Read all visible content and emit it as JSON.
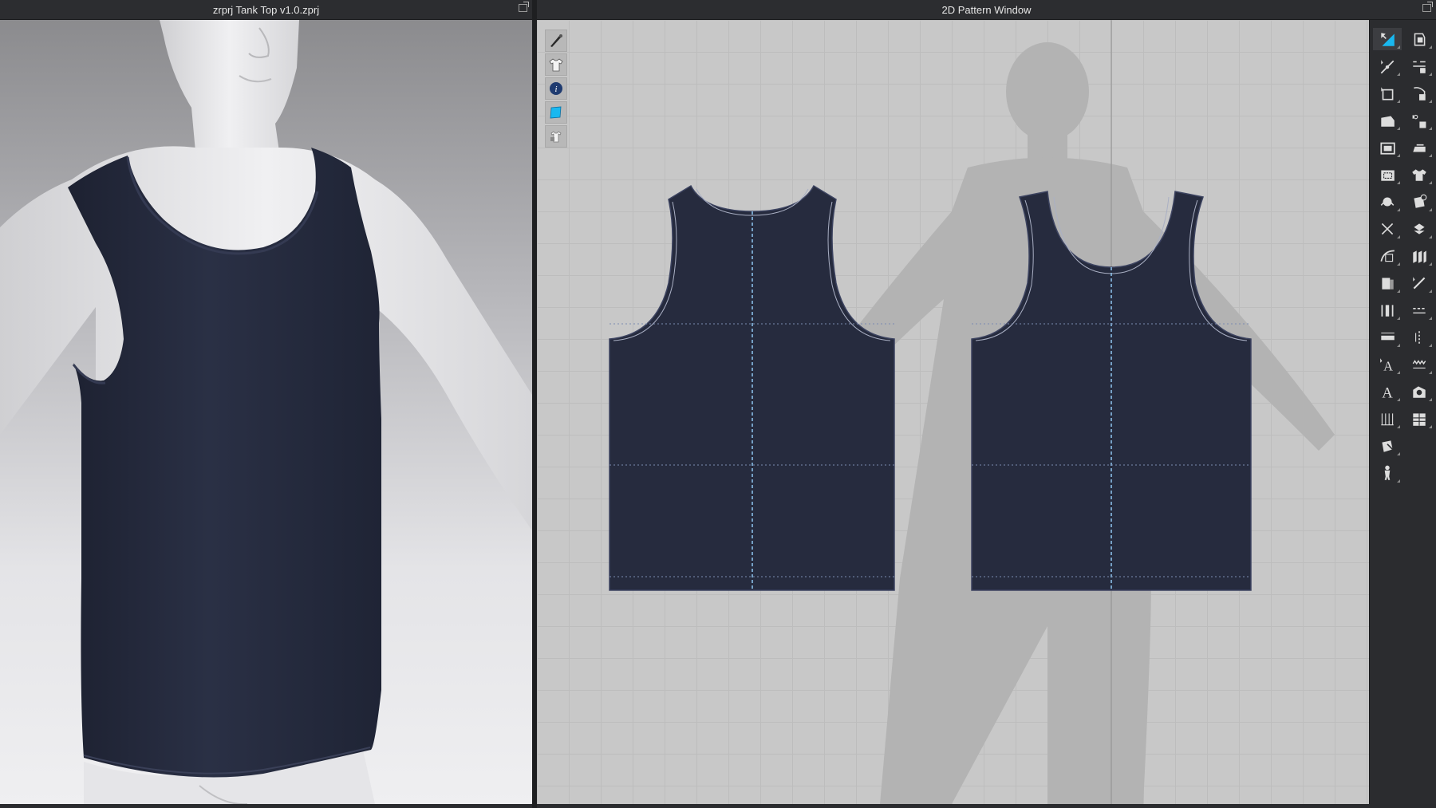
{
  "windows": {
    "view3d_title": "zrprj Tank Top v1.0.zprj",
    "view2d_title": "2D Pattern Window"
  },
  "colors": {
    "garment": "#262b3e",
    "avatar": "#e2e2e4",
    "highlight": "#19b8f0"
  },
  "mini_tools": [
    {
      "icon": "brush-icon"
    },
    {
      "icon": "shirt-icon"
    },
    {
      "icon": "info-icon"
    },
    {
      "icon": "fabric-icon"
    },
    {
      "icon": "lock-shirt-icon"
    }
  ],
  "toolbar": {
    "left": [
      "select-pattern-icon",
      "edit-pattern-icon",
      "transform-pattern-icon",
      "polygon-icon",
      "rectangle-icon",
      "internal-rectangle-icon",
      "dart-icon",
      "cut-icon",
      "edit-curvature-icon",
      "fold-icon",
      "segment-icon",
      "ruler-icon",
      "text-a-icon",
      "text-style-icon",
      "grid-icon",
      "trim-icon",
      "avatar-measure-icon"
    ],
    "right": [
      "seam-icon",
      "segment-sewing-icon",
      "free-sewing-icon",
      "sewing-check-icon",
      "iron-icon",
      "shirt-symmetry-icon",
      "puckering-icon",
      "fold-arrange-icon",
      "layer-icon",
      "tape-icon",
      "stitch-icon",
      "topstitch-icon",
      "zigzag-stitch-icon",
      "button-icon",
      "buttonhole-icon"
    ]
  }
}
